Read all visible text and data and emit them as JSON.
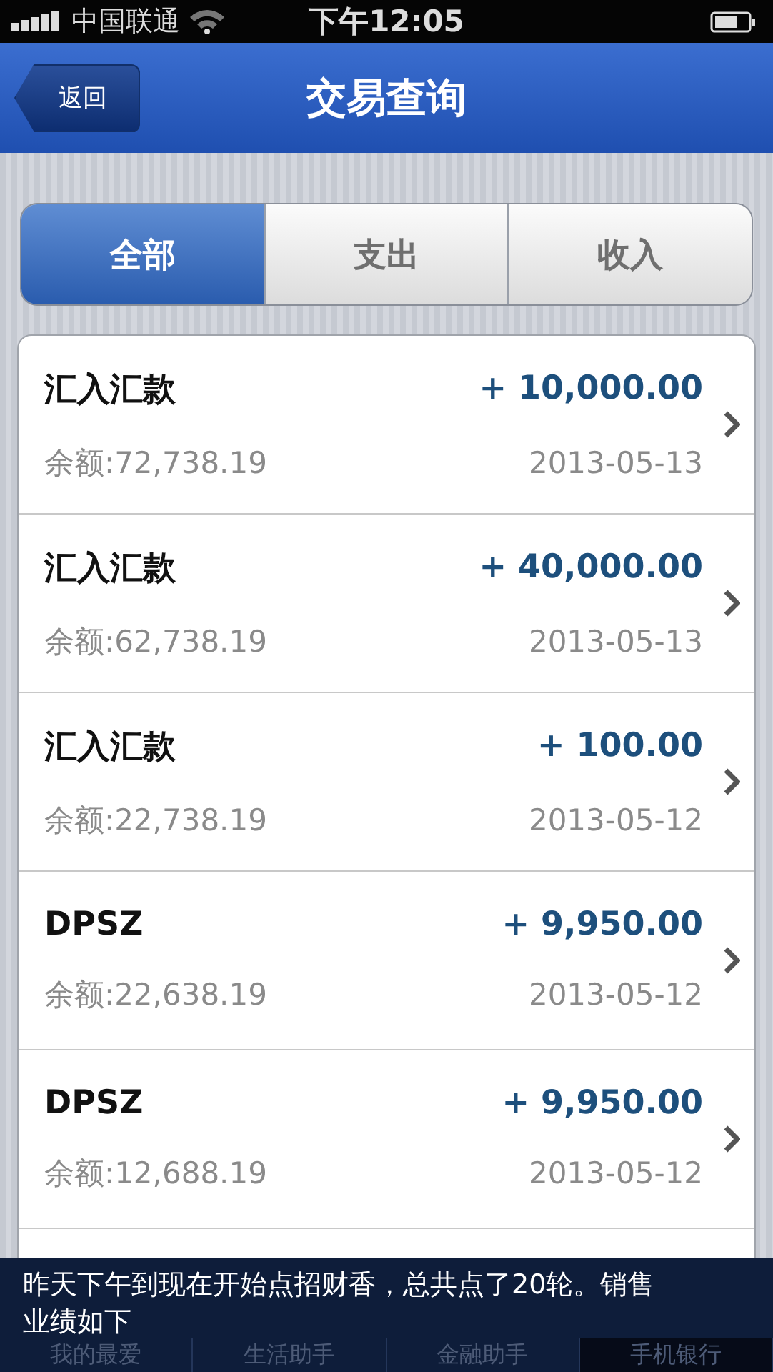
{
  "status_bar": {
    "carrier": "中国联通",
    "time": "下午12:05"
  },
  "nav": {
    "back": "返回",
    "title": "交易查询"
  },
  "segments": [
    {
      "label": "全部",
      "selected": true
    },
    {
      "label": "支出",
      "selected": false
    },
    {
      "label": "收入",
      "selected": false
    }
  ],
  "transactions": [
    {
      "title": "汇入汇款",
      "amount": "+ 10,000.00",
      "balance": "余额:72,738.19",
      "date": "2013-05-13"
    },
    {
      "title": "汇入汇款",
      "amount": "+ 40,000.00",
      "balance": "余额:62,738.19",
      "date": "2013-05-13"
    },
    {
      "title": "汇入汇款",
      "amount": "+ 100.00",
      "balance": "余额:22,738.19",
      "date": "2013-05-12"
    },
    {
      "title": "DPSZ",
      "amount": "+ 9,950.00",
      "balance": "余额:22,638.19",
      "date": "2013-05-12"
    },
    {
      "title": "DPSZ",
      "amount": "+ 9,950.00",
      "balance": "余额:12,688.19",
      "date": "2013-05-12"
    }
  ],
  "tab_bar": [
    {
      "label": "我的最爱",
      "selected": false
    },
    {
      "label": "生活助手",
      "selected": false
    },
    {
      "label": "金融助手",
      "selected": false
    },
    {
      "label": "手机银行",
      "selected": true
    }
  ],
  "caption": "昨天下午到现在开始点招财香，总共点了20轮。销售业绩如下"
}
